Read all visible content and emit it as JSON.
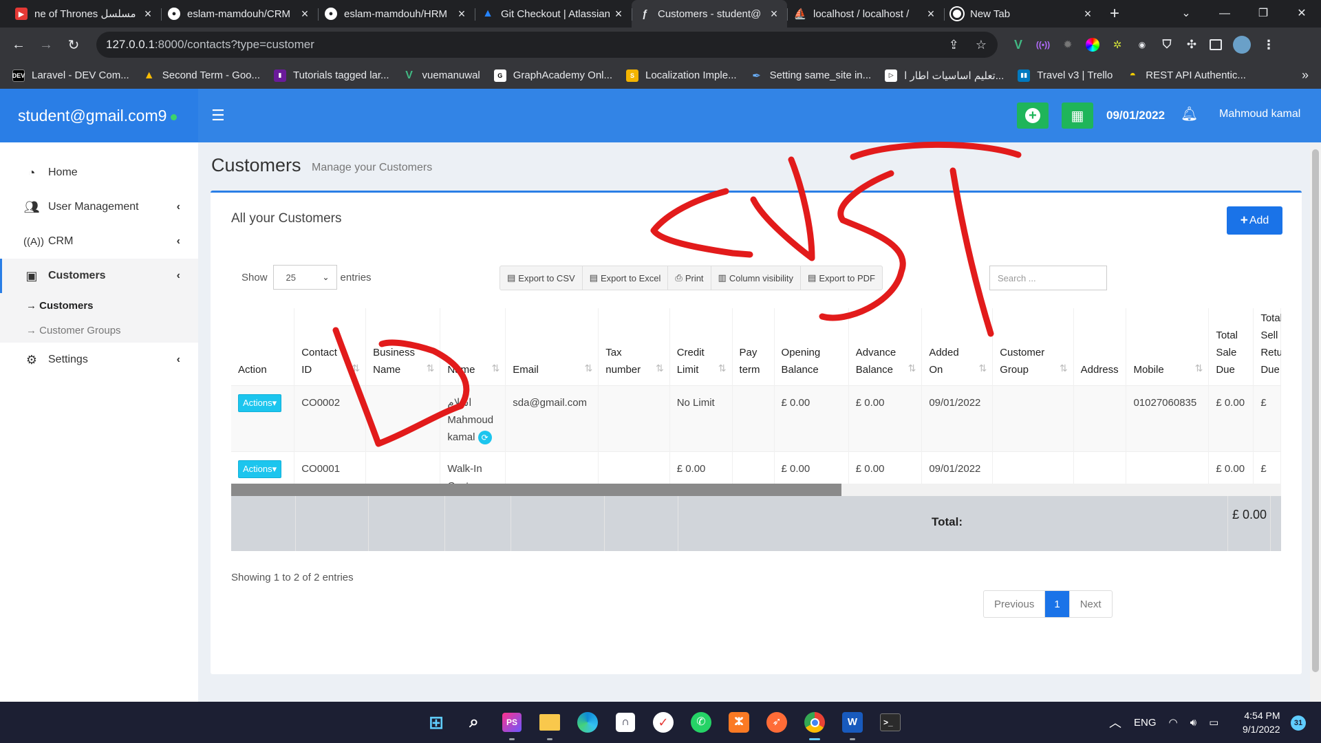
{
  "browser": {
    "tabs": [
      {
        "label": "ne of Thrones مسلسل",
        "icon": "tv-site-icon",
        "color": "#e53935"
      },
      {
        "label": "eslam-mamdouh/CRM",
        "icon": "github-icon",
        "color": "#ffffff"
      },
      {
        "label": "eslam-mamdouh/HRM",
        "icon": "github-icon",
        "color": "#ffffff"
      },
      {
        "label": "Git Checkout | Atlassian",
        "icon": "atlassian-icon",
        "color": "#2684ff"
      },
      {
        "label": "Customers - student@",
        "icon": "symfony-icon",
        "color": "#ffffff",
        "active": true
      },
      {
        "label": "localhost / localhost /",
        "icon": "phpmyadmin-icon",
        "color": "#f89c0e"
      },
      {
        "label": "New Tab",
        "icon": "chrome-icon",
        "color": "#ffffff"
      }
    ],
    "url_host": "127.0.0.1",
    "url_rest": ":8000/contacts?type=customer",
    "bookmarks": [
      {
        "label": "Laravel - DEV Com...",
        "icon": "dev-icon",
        "color": "#000000"
      },
      {
        "label": "Second Term - Goo...",
        "icon": "google-drive-icon",
        "color": "#34a853"
      },
      {
        "label": "Tutorials tagged lar...",
        "icon": "bookmark-icon",
        "color": "#6a1b9a"
      },
      {
        "label": "vuemanuwal",
        "icon": "vue-icon",
        "color": "#41b883"
      },
      {
        "label": "GraphAcademy Onl...",
        "icon": "neo4j-icon",
        "color": "#ffffff"
      },
      {
        "label": "Localization Imple...",
        "icon": "s-icon",
        "color": "#f4b400"
      },
      {
        "label": "Setting same_site in...",
        "icon": "feather-icon",
        "color": "#ffffff"
      },
      {
        "label": "تعليم اساسيات اطار ا...",
        "icon": "play-icon",
        "color": "#ffffff"
      },
      {
        "label": "Travel v3 | Trello",
        "icon": "trello-icon",
        "color": "#0079bf"
      },
      {
        "label": "REST API Authentic...",
        "icon": "ufo-icon",
        "color": "#f5d000"
      }
    ]
  },
  "app": {
    "brand": "student@gmail.com9",
    "date": "09/01/2022",
    "user": "Mahmoud kamal",
    "accent": "#3284e6",
    "sidebar": [
      {
        "label": "Home",
        "icon": "dashboard-icon"
      },
      {
        "label": "User Management",
        "icon": "users-icon"
      },
      {
        "label": "CRM",
        "icon": "broadcast-icon"
      },
      {
        "label": "Customers",
        "icon": "address-book-icon",
        "active": true
      },
      {
        "label": "Settings",
        "icon": "gear-icon"
      }
    ],
    "submenu": [
      {
        "label": "→ Customers",
        "active": true
      },
      {
        "label": "→ Customer Groups",
        "active": false
      }
    ],
    "page_title": "Customers",
    "page_subtitle": "Manage your Customers",
    "box_title": "All your Customers",
    "add_label": "Add",
    "show_label": "Show",
    "entries_label": "entries",
    "page_length": "25",
    "export_buttons": [
      "Export to CSV",
      "Export to Excel",
      "Print",
      "Column visibility",
      "Export to PDF"
    ],
    "search_placeholder": "Search ...",
    "columns": [
      "Action",
      "Contact ID",
      "Business Name",
      "Name",
      "Email",
      "Tax number",
      "Credit Limit",
      "Pay term",
      "Opening Balance",
      "Advance Balance",
      "Added On",
      "Customer Group",
      "Address",
      "Mobile",
      "Total Sale Due",
      "Total Sell Return Due"
    ],
    "rows": [
      {
        "action": "Actions",
        "contact_id": "CO0002",
        "business": "",
        "name": "اسلام Mahmoud kamal",
        "email": "sda@gmail.com",
        "tax": "",
        "credit": "No Limit",
        "pay_term": "",
        "opening": "£ 0.00",
        "advance": "£ 0.00",
        "added": "09/01/2022",
        "group": "",
        "address": "",
        "mobile": "01027060835",
        "due": "£ 0.00",
        "return_due": "£"
      },
      {
        "action": "Actions",
        "contact_id": "CO0001",
        "business": "",
        "name": "Walk-In Customer",
        "email": "",
        "tax": "",
        "credit": "£ 0.00",
        "pay_term": "",
        "opening": "£ 0.00",
        "advance": "£ 0.00",
        "added": "09/01/2022",
        "group": "",
        "address": "",
        "mobile": "",
        "due": "£ 0.00",
        "return_due": "£"
      }
    ],
    "total_label": "Total:",
    "total_value": "£ 0.00",
    "info": "Showing 1 to 2 of 2 entries",
    "pager": {
      "prev": "Previous",
      "current": "1",
      "next": "Next"
    }
  },
  "taskbar": {
    "lang": "ENG",
    "time": "4:54 PM",
    "date": "9/1/2022",
    "notifications": "31"
  }
}
